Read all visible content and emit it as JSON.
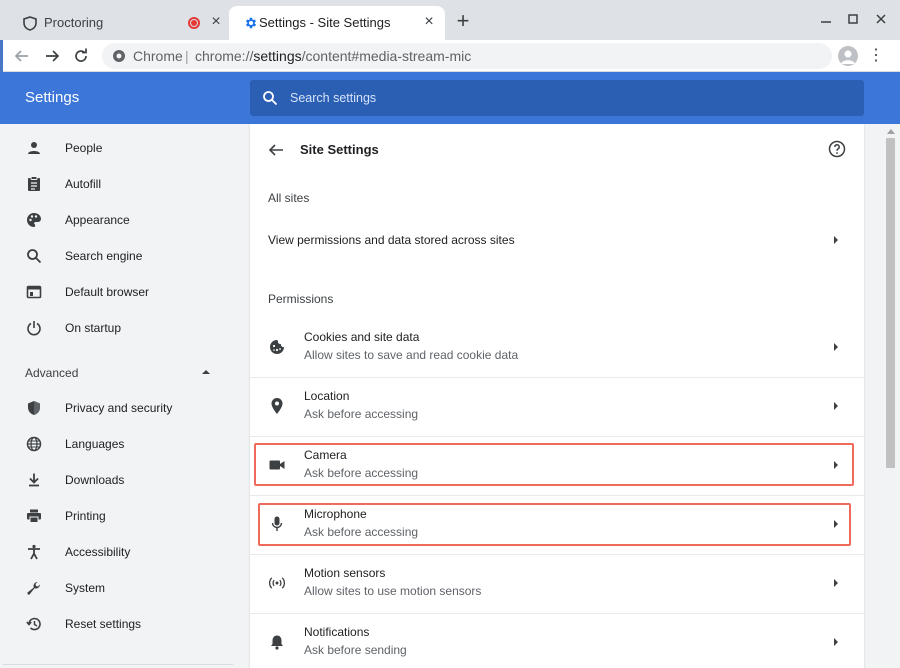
{
  "tabs": [
    {
      "title": "Proctoring",
      "favicon": "shield-icon",
      "recording": true
    },
    {
      "title": "Settings - Site Settings",
      "favicon": "gear-icon",
      "active": true
    }
  ],
  "toolbar": {
    "origin_chip": "Chrome",
    "url_prefix": "chrome://",
    "url_host": "settings",
    "url_path": "/content#media-stream-mic"
  },
  "header": {
    "title": "Settings",
    "search_placeholder": "Search settings"
  },
  "sidebar": {
    "items": [
      {
        "label": "People",
        "icon": "person-icon"
      },
      {
        "label": "Autofill",
        "icon": "clipboard-icon"
      },
      {
        "label": "Appearance",
        "icon": "palette-icon"
      },
      {
        "label": "Search engine",
        "icon": "search-icon"
      },
      {
        "label": "Default browser",
        "icon": "browser-icon"
      },
      {
        "label": "On startup",
        "icon": "power-icon"
      }
    ],
    "advanced_label": "Advanced",
    "advanced_items": [
      {
        "label": "Privacy and security",
        "icon": "shield-icon"
      },
      {
        "label": "Languages",
        "icon": "globe-icon"
      },
      {
        "label": "Downloads",
        "icon": "download-icon"
      },
      {
        "label": "Printing",
        "icon": "printer-icon"
      },
      {
        "label": "Accessibility",
        "icon": "accessibility-icon"
      },
      {
        "label": "System",
        "icon": "wrench-icon"
      },
      {
        "label": "Reset settings",
        "icon": "history-icon"
      }
    ]
  },
  "main": {
    "title": "Site Settings",
    "all_sites_heading": "All sites",
    "all_sites_link": "View permissions and data stored across sites",
    "permissions_heading": "Permissions",
    "permissions": [
      {
        "title": "Cookies and site data",
        "subtitle": "Allow sites to save and read cookie data",
        "icon": "cookie-icon"
      },
      {
        "title": "Location",
        "subtitle": "Ask before accessing",
        "icon": "location-pin-icon"
      },
      {
        "title": "Camera",
        "subtitle": "Ask before accessing",
        "icon": "camera-icon",
        "highlighted": true
      },
      {
        "title": "Microphone",
        "subtitle": "Ask before accessing",
        "icon": "microphone-icon",
        "highlighted": true
      },
      {
        "title": "Motion sensors",
        "subtitle": "Allow sites to use motion sensors",
        "icon": "sensors-icon"
      },
      {
        "title": "Notifications",
        "subtitle": "Ask before sending",
        "icon": "bell-icon"
      }
    ]
  },
  "colors": {
    "header_blue": "#3b76d8",
    "search_blue": "#2b5fb4",
    "highlight": "#ef6a5b",
    "recording_red": "#e53935",
    "settings_favicon": "#1a73e8"
  }
}
